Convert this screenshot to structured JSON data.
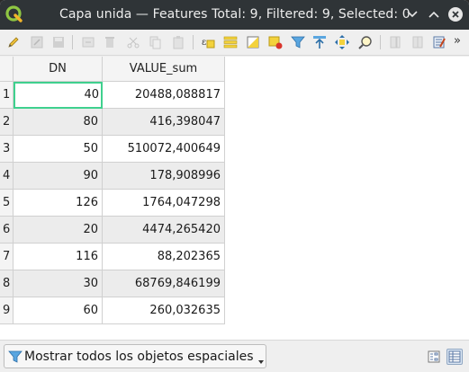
{
  "window": {
    "title": "Capa unida — Features Total: 9, Filtered: 9, Selected: 0"
  },
  "toolbar": {
    "more_label": "»",
    "icons": [
      "pencil-icon",
      "multi-edit-icon",
      "save-icon",
      "reload-icon",
      "add-feature-icon",
      "delete-icon",
      "cut-icon",
      "copy-icon",
      "paste-icon",
      "select-expression-icon",
      "select-all-icon",
      "invert-selection-icon",
      "deselect-all-icon",
      "filter-icon",
      "move-to-top-icon",
      "pan-to-selection-icon",
      "zoom-to-selection-icon",
      "new-field-icon",
      "delete-field-icon",
      "field-calculator-icon"
    ]
  },
  "table": {
    "columns": [
      "DN",
      "VALUE_sum"
    ],
    "rows": [
      {
        "index": "1",
        "dn": "40",
        "value": "20488,088817"
      },
      {
        "index": "2",
        "dn": "80",
        "value": "416,398047"
      },
      {
        "index": "3",
        "dn": "50",
        "value": "510072,400649"
      },
      {
        "index": "4",
        "dn": "90",
        "value": "178,908996"
      },
      {
        "index": "5",
        "dn": "126",
        "value": "1764,047298"
      },
      {
        "index": "6",
        "dn": "20",
        "value": "4474,265420"
      },
      {
        "index": "7",
        "dn": "116",
        "value": "88,202365"
      },
      {
        "index": "8",
        "dn": "30",
        "value": "68769,846199"
      },
      {
        "index": "9",
        "dn": "60",
        "value": "260,032635"
      }
    ]
  },
  "bottom": {
    "filter_label": "Mostrar todos los objetos espaciales"
  },
  "colors": {
    "titlebar": "#2f3437",
    "focus_border": "#3fd08e",
    "alt_row": "#ececec"
  }
}
